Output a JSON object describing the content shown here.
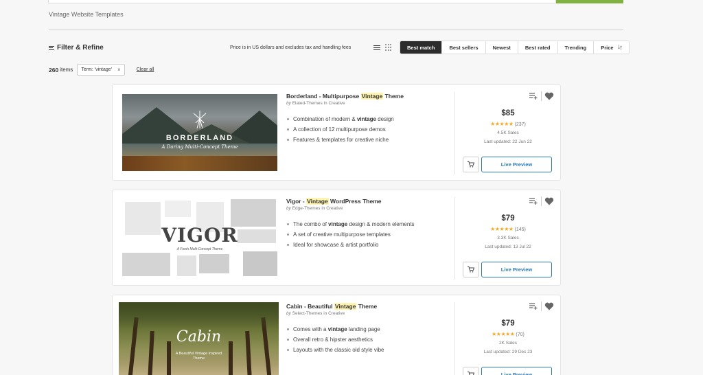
{
  "breadcrumb": "Vintage Website Templates",
  "filter_label": "Filter & Refine",
  "price_note": "Price is in US dollars and excludes tax and handling fees",
  "sort_tabs": [
    "Best match",
    "Best sellers",
    "Newest",
    "Best rated",
    "Trending",
    "Price"
  ],
  "active_sort": "Best match",
  "results": {
    "count": "260",
    "label": "items",
    "term_chip": "Term: 'vintage'",
    "clear_all": "Clear all"
  },
  "items": [
    {
      "title_pre": "Borderland - Multipurpose ",
      "title_mark": "Vintage",
      "title_post": " Theme",
      "by_prefix": "by",
      "author": "Elated-Themes",
      "in_word": "in",
      "category": "Creative",
      "bullets": [
        {
          "pre": "Combination of modern & ",
          "bold": "vintage",
          "post": " design"
        },
        {
          "pre": "A collection of 12 multipurpose demos",
          "bold": "",
          "post": ""
        },
        {
          "pre": "Features & templates for creative niche",
          "bold": "",
          "post": ""
        }
      ],
      "price": "$85",
      "stars": "★★★★★",
      "rating_count": "(237)",
      "rating": 4.5,
      "sales": "4.5K Sales",
      "updated": "Last updated: 22 Jun 22",
      "preview_label": "Live Preview",
      "thumb_title": "BORDERLAND",
      "thumb_subtitle": "A Daring Multi-Concept Theme"
    },
    {
      "title_pre": "Vigor - ",
      "title_mark": "Vintage",
      "title_post": " WordPress Theme",
      "by_prefix": "by",
      "author": "Edge-Themes",
      "in_word": "in",
      "category": "Creative",
      "bullets": [
        {
          "pre": "The combo of ",
          "bold": "vintage",
          "post": " design & modern elements"
        },
        {
          "pre": "A set of creative multipurpose templates",
          "bold": "",
          "post": ""
        },
        {
          "pre": "Ideal for showcase & artist portfolio",
          "bold": "",
          "post": ""
        }
      ],
      "price": "$79",
      "stars": "★★★★★",
      "rating_count": "(145)",
      "rating": 4.5,
      "sales": "3.3K Sales",
      "updated": "Last updated: 13 Jul 22",
      "preview_label": "Live Preview",
      "thumb_title": "VIGOR",
      "thumb_subtitle": "A Fresh Multi-Concept Theme"
    },
    {
      "title_pre": "Cabin - Beautiful ",
      "title_mark": "Vintage",
      "title_post": " Theme",
      "by_prefix": "by",
      "author": "Select-Themes",
      "in_word": "in",
      "category": "Creative",
      "bullets": [
        {
          "pre": "Comes with a ",
          "bold": "vintage",
          "post": " landing page"
        },
        {
          "pre": "Overall retro & hipster aesthetics",
          "bold": "",
          "post": ""
        },
        {
          "pre": "Layouts with the classic old style vibe",
          "bold": "",
          "post": ""
        }
      ],
      "price": "$79",
      "stars": "★★★★★",
      "rating_count": "(70)",
      "rating": 4.5,
      "sales": "2K Sales",
      "updated": "Last updated: 29 Dec 23",
      "preview_label": "Live Preview",
      "thumb_title": "Cabin",
      "thumb_subtitle": "A Beautiful Vintage Inspired Theme"
    }
  ],
  "colors": {
    "accent_green": "#7fb241",
    "preview_blue": "#2a7ab8",
    "star": "#f2a922",
    "highlight": "#fff3b0"
  }
}
